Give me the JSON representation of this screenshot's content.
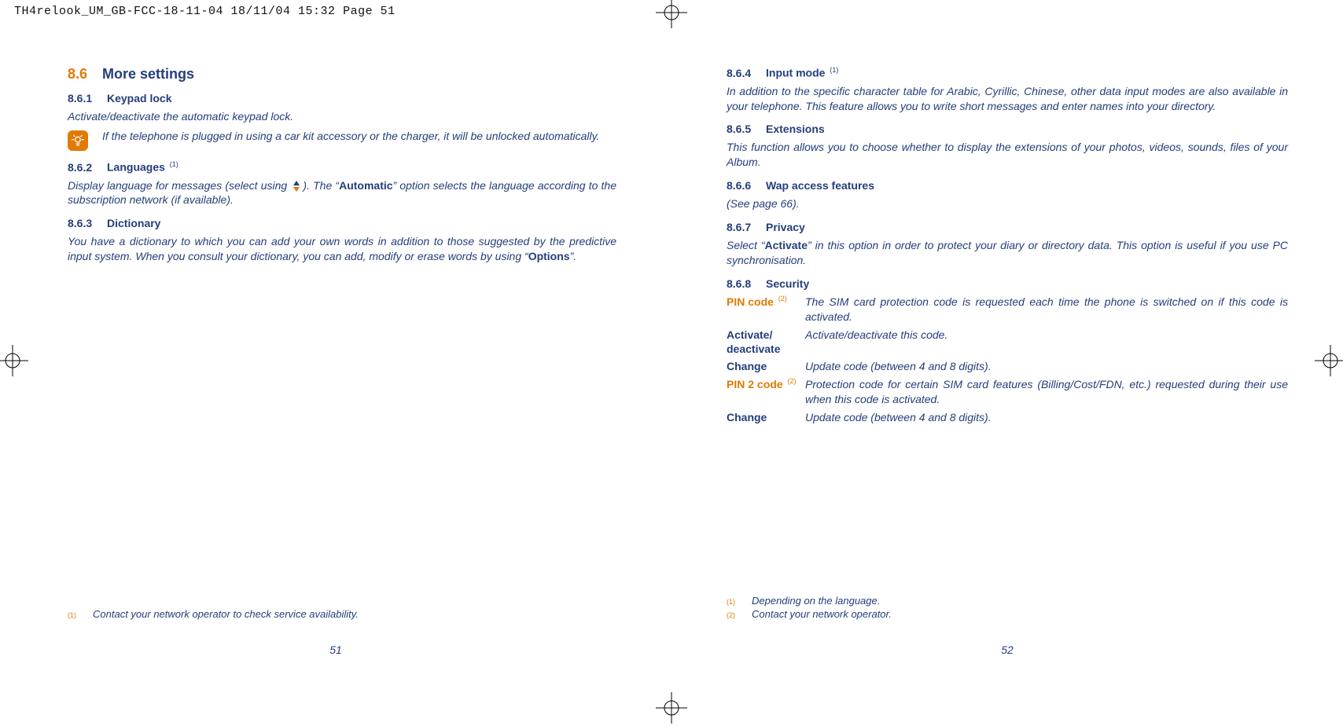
{
  "header": {
    "slug": "TH4relook_UM_GB-FCC-18-11-04  18/11/04  15:32  Page 51"
  },
  "left": {
    "h1_num": "8.6",
    "h1_title": "More settings",
    "s1": {
      "num": "8.6.1",
      "title": "Keypad lock",
      "para": "Activate/deactivate the automatic keypad lock.",
      "info": "If the telephone is plugged in using a car kit accessory or the charger, it will be unlocked automatically."
    },
    "s2": {
      "num": "8.6.2",
      "title": "Languages ",
      "sup": "(1)",
      "para_a": "Display language for messages (select using ",
      "para_b": "). The “",
      "para_strong": "Automatic",
      "para_c": "” option selects the language according to the subscription network (if available)."
    },
    "s3": {
      "num": "8.6.3",
      "title": "Dictionary",
      "para_a": "You have a dictionary to which you can add your own words in addition to those suggested by the predictive input system. When you consult your dictionary, you can add, modify or erase words by using “",
      "para_strong": "Options",
      "para_b": "”."
    },
    "footnotes": [
      {
        "mark": "(1)",
        "text": "Contact your network operator to check service availability."
      }
    ],
    "pageno": "51"
  },
  "right": {
    "s4": {
      "num": "8.6.4",
      "title": "Input mode ",
      "sup": "(1)",
      "para": "In addition to the specific character table for Arabic, Cyrillic, Chinese, other data input modes are also available in your telephone. This feature allows you to write short messages and enter names into your directory."
    },
    "s5": {
      "num": "8.6.5",
      "title": "Extensions",
      "para": "This function allows you to choose whether to display the extensions of your photos, videos, sounds, files of your Album."
    },
    "s6": {
      "num": "8.6.6",
      "title": "Wap access features",
      "para": "(See page 66)."
    },
    "s7": {
      "num": "8.6.7",
      "title": "Privacy",
      "para_a": "Select “",
      "para_strong": "Activate",
      "para_b": "” in this option in order to protect your diary or directory data. This option is useful if you use PC synchronisation."
    },
    "s8": {
      "num": "8.6.8",
      "title": "Security",
      "rows": [
        {
          "term": "PIN code ",
          "sup": "(2)",
          "orange": true,
          "def": "The SIM card protection code is requested each time the phone is switched on if this code is activated."
        },
        {
          "term": "Activate/ deactivate",
          "def": "Activate/deactivate this code."
        },
        {
          "term": "Change",
          "def": "Update code (between 4 and 8 digits)."
        },
        {
          "term": "PIN 2 code ",
          "sup": "(2)",
          "orange": true,
          "def": "Protection code for certain SIM card features (Billing/Cost/FDN, etc.) requested during their use when this code is activated."
        },
        {
          "term": "Change",
          "def": "Update code (between 4 and 8 digits)."
        }
      ]
    },
    "footnotes": [
      {
        "mark": "(1)",
        "text": "Depending on the language."
      },
      {
        "mark": "(2)",
        "text": "Contact your network operator."
      }
    ],
    "pageno": "52"
  }
}
